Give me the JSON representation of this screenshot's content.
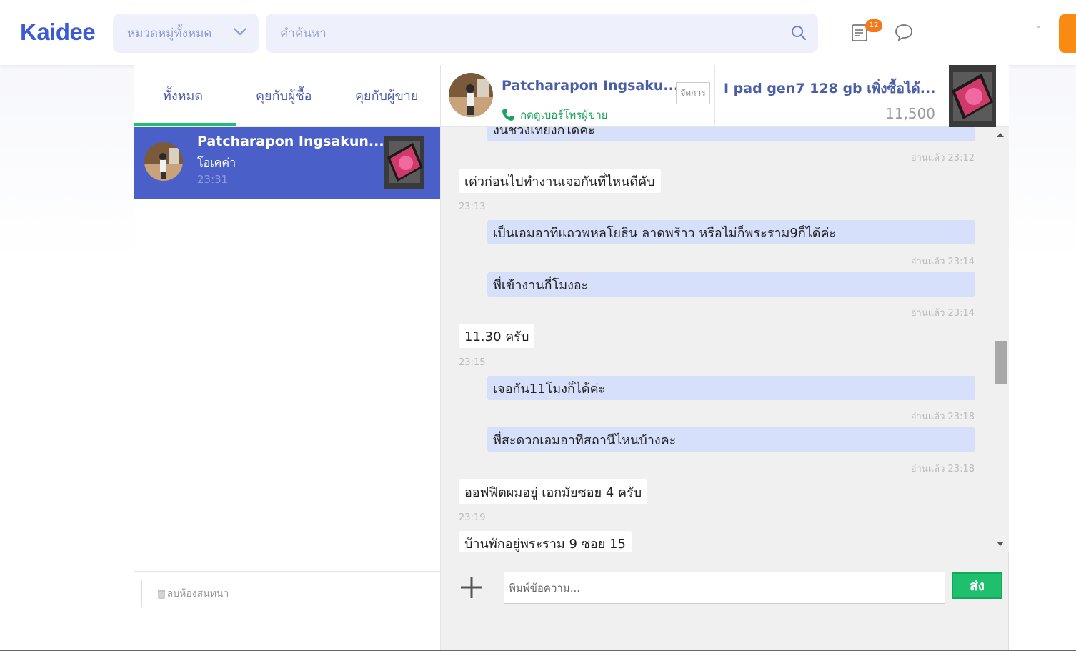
{
  "header": {
    "logo": "Kaidee",
    "category_label": "หมวดหมู่ทั้งหมด",
    "search_placeholder": "คำค้นหา",
    "notification_count": "12",
    "accent": "#3a5ad6"
  },
  "tabs": [
    {
      "label": "ทั้งหมด",
      "active": true
    },
    {
      "label": "คุยกับผู้ซื้อ",
      "active": false
    },
    {
      "label": "คุยกับผู้ขาย",
      "active": false
    }
  ],
  "conversation": {
    "name": "Patcharapon Ingsakun...",
    "last_message": "โอเคค่า",
    "time": "23:31"
  },
  "delete_room_label": "ลบห้องสนทนา",
  "chat_header": {
    "name": "Patcharapon Ingsaku...",
    "phone_label": "กดดูเบอร์โทรผู้ขาย",
    "manage_label": "จัดการ",
    "product_title": "I pad gen7 128 gb เพิ่งซื้อได้...",
    "product_price": "11,500"
  },
  "messages": [
    {
      "dir": "out",
      "text": "งั้นช่วงเที่ยงก็ได้ค่ะ",
      "meta": "อ่านแล้ว 23:12"
    },
    {
      "dir": "in",
      "text": "เด่วก่อนไปทำงานเจอกันที่ไหนดีคับ",
      "meta": "23:13"
    },
    {
      "dir": "out",
      "text": "เป็นเอมอาทีแถวพหลโยธิน ลาดพร้าว หรือไม่ก็พระราม9ก็ได้ค่ะ",
      "meta": "อ่านแล้ว 23:14"
    },
    {
      "dir": "out",
      "text": "พี่เข้างานกี่โมงอะ",
      "meta": "อ่านแล้ว 23:14"
    },
    {
      "dir": "in",
      "text": "11.30 ครับ",
      "meta": "23:15"
    },
    {
      "dir": "out",
      "text": "เจอกัน11โมงก็ได้ค่ะ",
      "meta": "อ่านแล้ว 23:18"
    },
    {
      "dir": "out",
      "text": "พี่สะดวกเอมอาทีสถานีไหนบ้างคะ",
      "meta": "อ่านแล้ว 23:18"
    },
    {
      "dir": "in",
      "text": "ออฟฟิตผมอยู่ เอกมัยซอย 4 ครับ",
      "meta": "23:19"
    },
    {
      "dir": "in",
      "text": "บ้านพักอยู่พระราม 9 ซอย 15",
      "meta": ""
    }
  ],
  "composer": {
    "placeholder": "พิมพ์ข้อความ...",
    "send_label": "ส่ง"
  }
}
